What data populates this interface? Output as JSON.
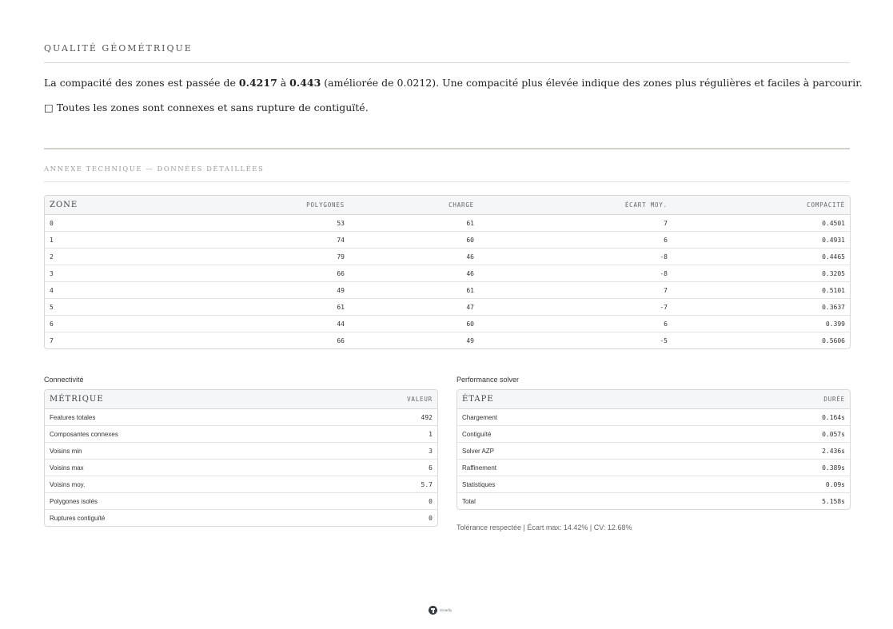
{
  "quality": {
    "title": "QUALITÉ GÉOMÉTRIQUE",
    "p1_before": "La compacité des zones est passée de ",
    "p1_from": "0.4217",
    "p1_mid": " à ",
    "p1_to": "0.443",
    "p1_after": " (améliorée de 0.0212). Une compacité plus élevée indique des zones plus régulières et faciles à parcourir.",
    "p2": "□ Toutes les zones sont connexes et sans rupture de contiguïté."
  },
  "annex": {
    "title": "ANNEXE TECHNIQUE — DONNÉES DÉTAILLÉES"
  },
  "zones": {
    "headers": [
      "ZONE",
      "POLYGONES",
      "CHARGE",
      "ÉCART MOY.",
      "COMPACITÉ"
    ],
    "rows": [
      [
        "0",
        "53",
        "61",
        "7",
        "0.4501"
      ],
      [
        "1",
        "74",
        "60",
        "6",
        "0.4931"
      ],
      [
        "2",
        "79",
        "46",
        "-8",
        "0.4465"
      ],
      [
        "3",
        "66",
        "46",
        "-8",
        "0.3205"
      ],
      [
        "4",
        "49",
        "61",
        "7",
        "0.5101"
      ],
      [
        "5",
        "61",
        "47",
        "-7",
        "0.3637"
      ],
      [
        "6",
        "44",
        "60",
        "6",
        "0.399"
      ],
      [
        "7",
        "66",
        "49",
        "-5",
        "0.5606"
      ]
    ]
  },
  "connectivity": {
    "title": "Connectivité",
    "headers": [
      "MÉTRIQUE",
      "VALEUR"
    ],
    "rows": [
      [
        "Features totales",
        "492"
      ],
      [
        "Composantes connexes",
        "1"
      ],
      [
        "Voisins min",
        "3"
      ],
      [
        "Voisins max",
        "6"
      ],
      [
        "Voisins moy.",
        "5.7"
      ],
      [
        "Polygones isolés",
        "0"
      ],
      [
        "Ruptures contiguïté",
        "0"
      ]
    ]
  },
  "performance": {
    "title": "Performance solver",
    "headers": [
      "ÉTAPE",
      "DURÉE"
    ],
    "rows": [
      [
        "Chargement",
        "0.164s"
      ],
      [
        "Contiguïté",
        "0.057s"
      ],
      [
        "Solver AZP",
        "2.436s"
      ],
      [
        "Raffinement",
        "0.389s"
      ],
      [
        "Statistiques",
        "0.09s"
      ],
      [
        "Total",
        "5.158s"
      ]
    ],
    "tolerance": "Tolérance respectée | Écart max: 14.42% | CV: 12.68%"
  },
  "footer": {
    "logo_text": "Smartly",
    "logo_icon": "logo-mark-icon"
  }
}
